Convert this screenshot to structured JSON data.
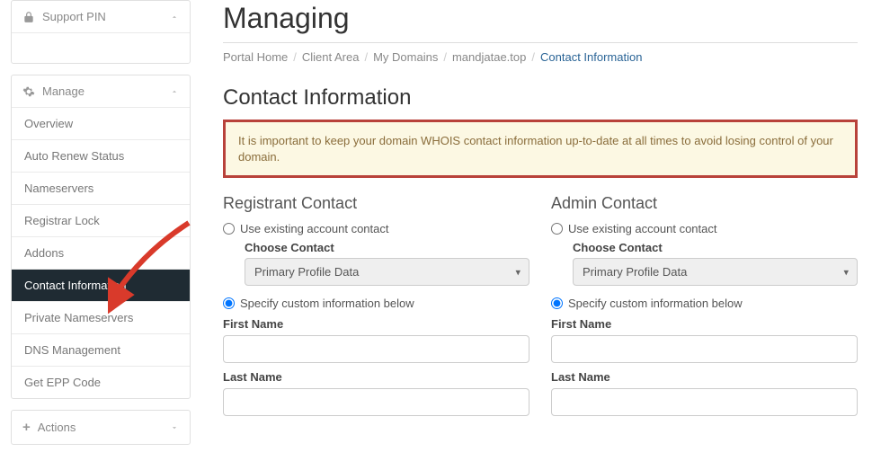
{
  "page_title": "Managing",
  "breadcrumb": {
    "items": [
      "Portal Home",
      "Client Area",
      "My Domains",
      "mandjatae.top"
    ],
    "current": "Contact Information"
  },
  "section_title": "Contact Information",
  "alert_text": "It is important to keep your domain WHOIS contact information up-to-date at all times to avoid losing control of your domain.",
  "sidebar": {
    "support_pin_label": "Support PIN",
    "manage_label": "Manage",
    "actions_label": "Actions",
    "manage_items": [
      "Overview",
      "Auto Renew Status",
      "Nameservers",
      "Registrar Lock",
      "Addons",
      "Contact Information",
      "Private Nameservers",
      "DNS Management",
      "Get EPP Code"
    ],
    "manage_active_index": 5
  },
  "contact_form": {
    "registrant_heading": "Registrant Contact",
    "admin_heading": "Admin Contact",
    "radio_existing_label": "Use existing account contact",
    "radio_custom_label": "Specify custom information below",
    "choose_contact_label": "Choose Contact",
    "select_value": "Primary Profile Data",
    "first_name_label": "First Name",
    "last_name_label": "Last Name",
    "registrant_selected": "custom",
    "admin_selected": "custom"
  }
}
